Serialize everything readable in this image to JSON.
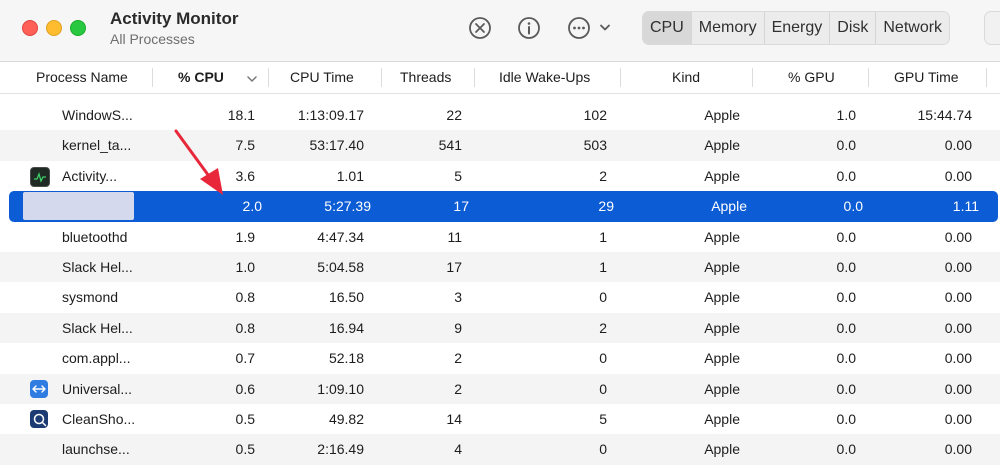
{
  "window": {
    "title": "Activity Monitor",
    "subtitle": "All Processes"
  },
  "toolbar": {
    "stop_icon": "x-circle-icon",
    "info_icon": "info-icon",
    "more_icon": "ellipsis-circle-icon",
    "tabs": [
      "CPU",
      "Memory",
      "Energy",
      "Disk",
      "Network"
    ],
    "active_tab": "CPU"
  },
  "table": {
    "columns": [
      "Process Name",
      "% CPU",
      "CPU Time",
      "Threads",
      "Idle Wake-Ups",
      "Kind",
      "% GPU",
      "GPU Time"
    ],
    "sort_column": "% CPU",
    "sort_direction": "descending",
    "rows": [
      {
        "name": "WindowS...",
        "cpu": "18.1",
        "cpu_time": "1:13:09.17",
        "threads": "22",
        "idle": "102",
        "kind": "Apple",
        "gpu": "1.0",
        "gpu_time": "15:44.74",
        "icon": ""
      },
      {
        "name": "kernel_ta...",
        "cpu": "7.5",
        "cpu_time": "53:17.40",
        "threads": "541",
        "idle": "503",
        "kind": "Apple",
        "gpu": "0.0",
        "gpu_time": "0.00",
        "icon": ""
      },
      {
        "name": "Activity...",
        "cpu": "3.6",
        "cpu_time": "1.01",
        "threads": "5",
        "idle": "2",
        "kind": "Apple",
        "gpu": "0.0",
        "gpu_time": "0.00",
        "icon": "activity-monitor-icon"
      },
      {
        "name": "",
        "cpu": "2.0",
        "cpu_time": "5:27.39",
        "threads": "17",
        "idle": "29",
        "kind": "Apple",
        "gpu": "0.0",
        "gpu_time": "1.11",
        "icon": "",
        "selected": true
      },
      {
        "name": "bluetoothd",
        "cpu": "1.9",
        "cpu_time": "4:47.34",
        "threads": "11",
        "idle": "1",
        "kind": "Apple",
        "gpu": "0.0",
        "gpu_time": "0.00",
        "icon": ""
      },
      {
        "name": "Slack Hel...",
        "cpu": "1.0",
        "cpu_time": "5:04.58",
        "threads": "17",
        "idle": "1",
        "kind": "Apple",
        "gpu": "0.0",
        "gpu_time": "0.00",
        "icon": ""
      },
      {
        "name": "sysmond",
        "cpu": "0.8",
        "cpu_time": "16.50",
        "threads": "3",
        "idle": "0",
        "kind": "Apple",
        "gpu": "0.0",
        "gpu_time": "0.00",
        "icon": ""
      },
      {
        "name": "Slack Hel...",
        "cpu": "0.8",
        "cpu_time": "16.94",
        "threads": "9",
        "idle": "2",
        "kind": "Apple",
        "gpu": "0.0",
        "gpu_time": "0.00",
        "icon": ""
      },
      {
        "name": "com.appl...",
        "cpu": "0.7",
        "cpu_time": "52.18",
        "threads": "2",
        "idle": "0",
        "kind": "Apple",
        "gpu": "0.0",
        "gpu_time": "0.00",
        "icon": ""
      },
      {
        "name": "Universal...",
        "cpu": "0.6",
        "cpu_time": "1:09.10",
        "threads": "2",
        "idle": "0",
        "kind": "Apple",
        "gpu": "0.0",
        "gpu_time": "0.00",
        "icon": "universal-control-icon"
      },
      {
        "name": "CleanSho...",
        "cpu": "0.5",
        "cpu_time": "49.82",
        "threads": "14",
        "idle": "5",
        "kind": "Apple",
        "gpu": "0.0",
        "gpu_time": "0.00",
        "icon": "cleanshot-icon"
      },
      {
        "name": "launchse...",
        "cpu": "0.5",
        "cpu_time": "2:16.49",
        "threads": "4",
        "idle": "0",
        "kind": "Apple",
        "gpu": "0.0",
        "gpu_time": "0.00",
        "icon": ""
      }
    ]
  },
  "annotation": {
    "icon": "red-arrow-icon",
    "color": "#e8283a"
  },
  "colors": {
    "selection": "#0b5cd5",
    "stripe": "#f4f4f4"
  }
}
